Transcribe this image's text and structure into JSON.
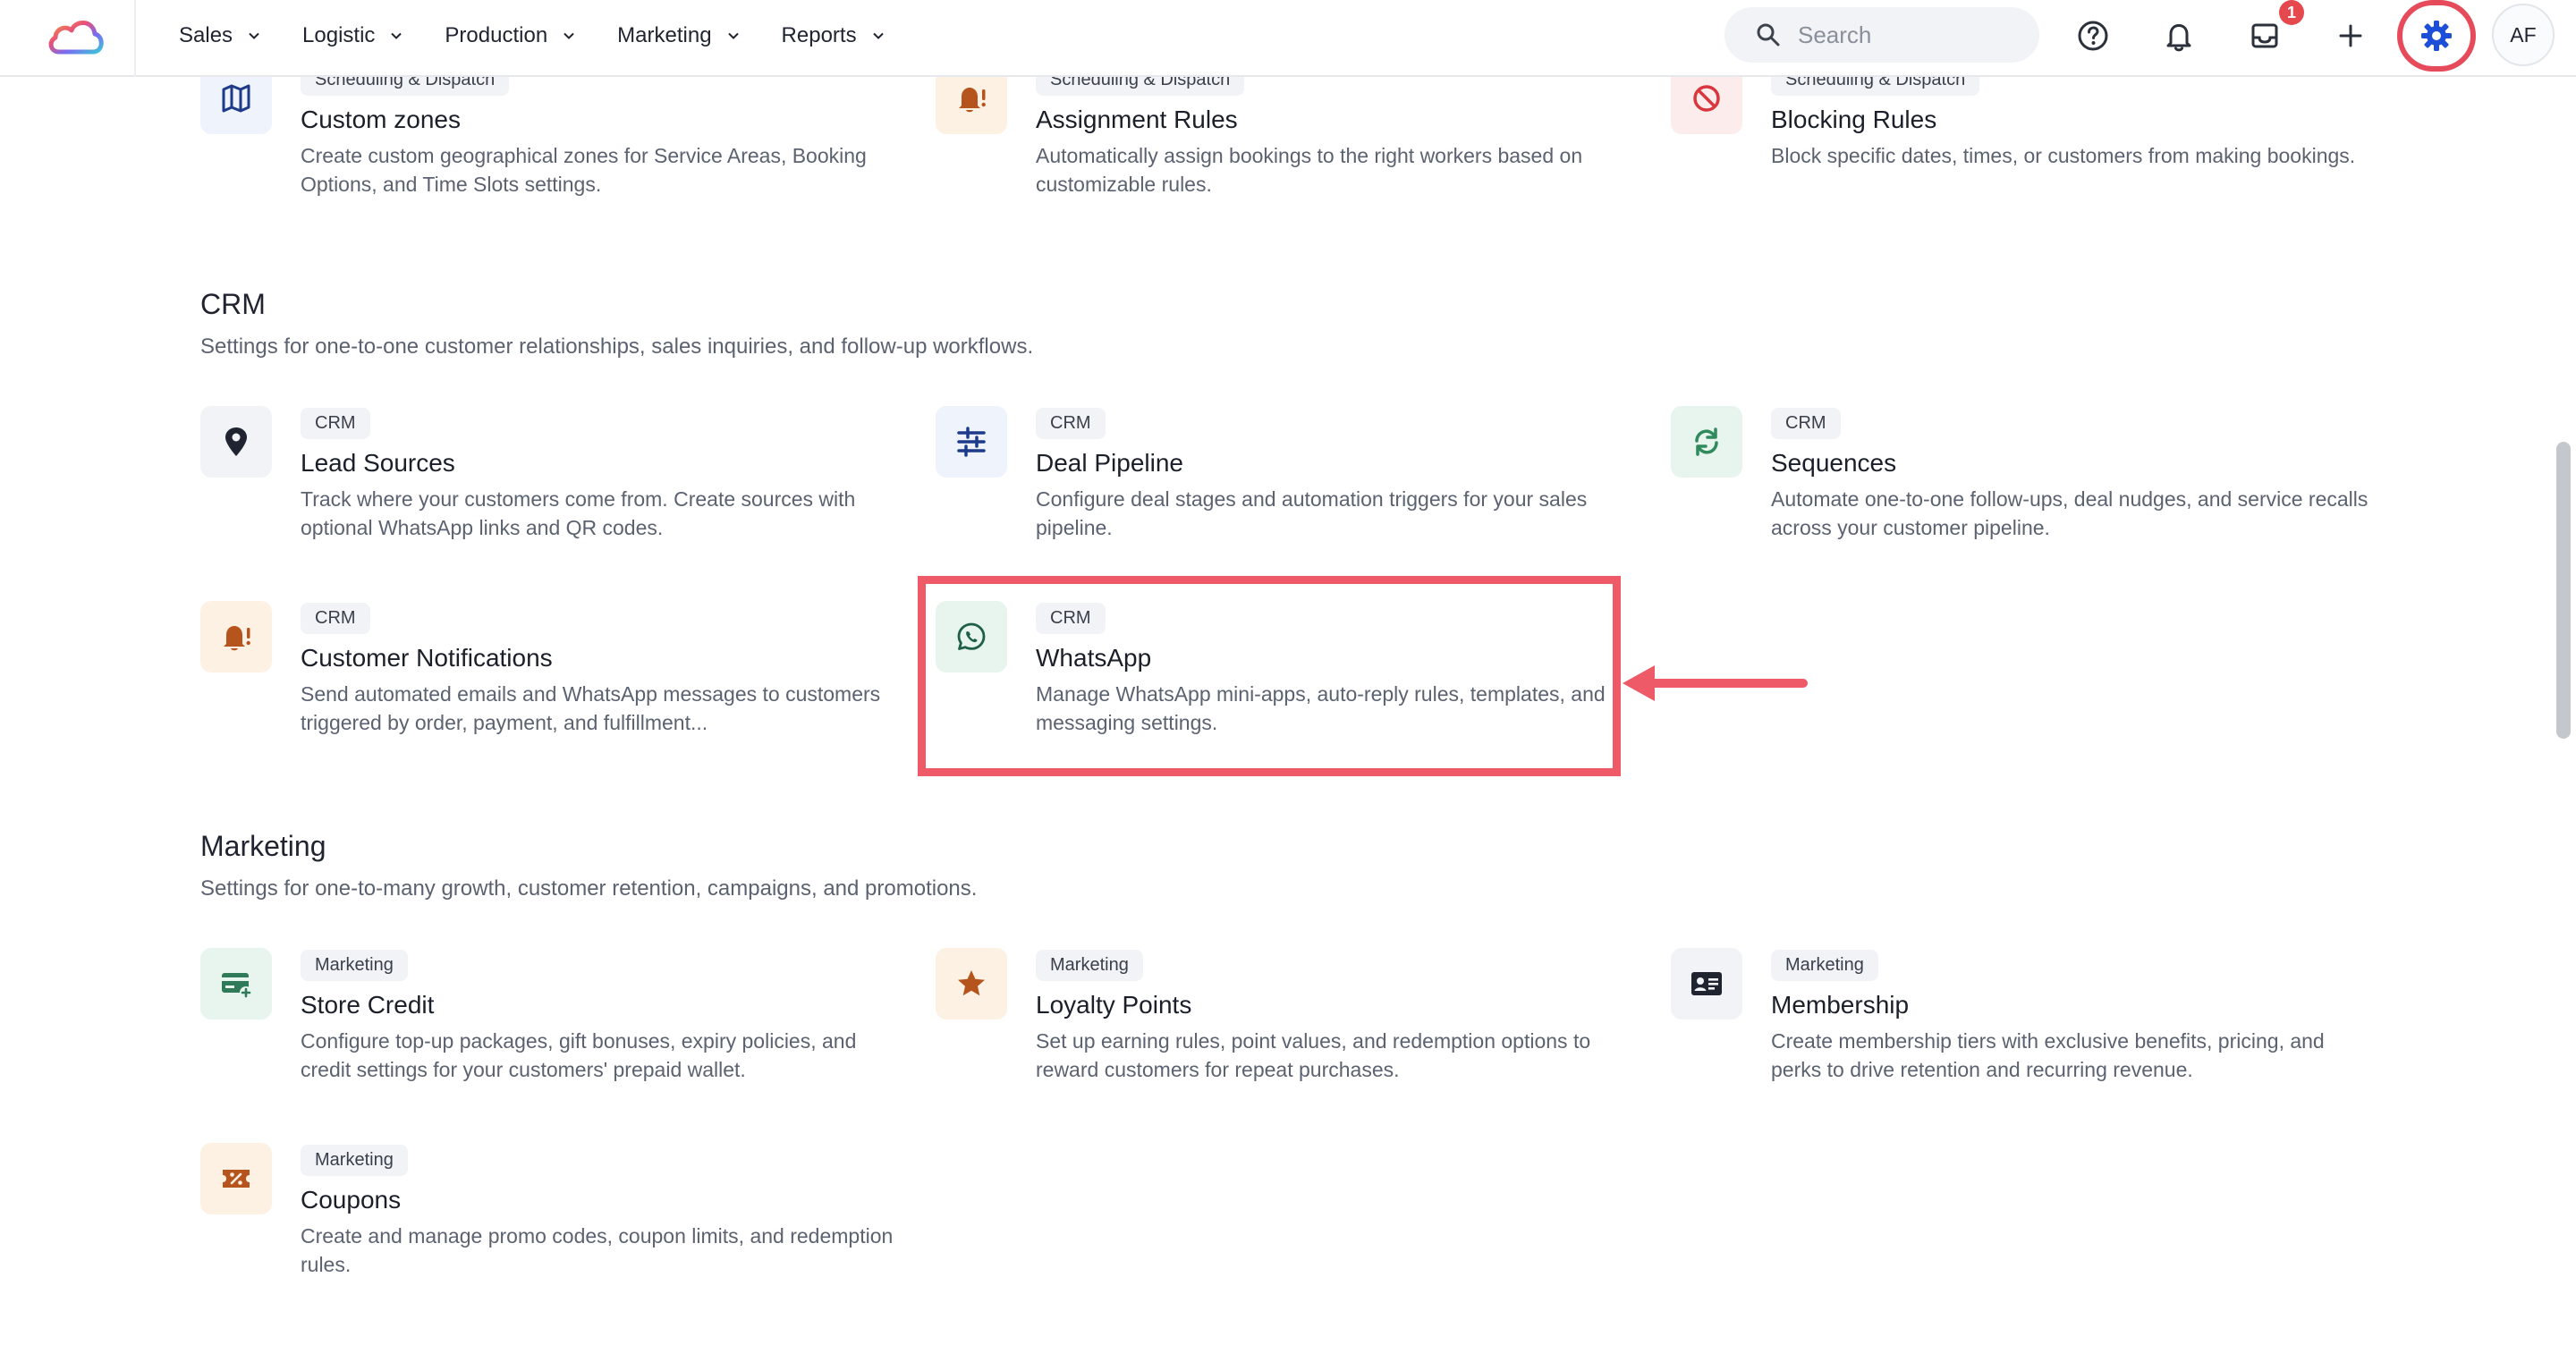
{
  "nav": {
    "items": [
      {
        "label": "Sales"
      },
      {
        "label": "Logistic"
      },
      {
        "label": "Production"
      },
      {
        "label": "Marketing"
      },
      {
        "label": "Reports"
      }
    ]
  },
  "search": {
    "placeholder": "Search"
  },
  "header_icons": {
    "help": "help-circle-icon",
    "notifications": "bell-icon",
    "inbox": "inbox-icon",
    "inbox_badge": "1",
    "add": "plus-icon",
    "settings": "gear-icon",
    "avatar_initials": "AF"
  },
  "top_cards": [
    {
      "tag": "Scheduling & Dispatch",
      "title": "Custom zones",
      "desc": "Create custom geographical zones for Service Areas, Booking Options, and Time Slots settings.",
      "icon": "map-icon"
    },
    {
      "tag": "Scheduling & Dispatch",
      "title": "Assignment Rules",
      "desc": "Automatically assign bookings to the right workers based on customizable rules.",
      "icon": "bell-alert-icon"
    },
    {
      "tag": "Scheduling & Dispatch",
      "title": "Blocking Rules",
      "desc": "Block specific dates, times, or customers from making bookings.",
      "icon": "block-icon"
    }
  ],
  "crm": {
    "title": "CRM",
    "desc": "Settings for one-to-one customer relationships, sales inquiries, and follow-up workflows.",
    "cards": [
      {
        "tag": "CRM",
        "title": "Lead Sources",
        "desc": "Track where your customers come from. Create sources with optional WhatsApp links and QR codes.",
        "icon": "location-pin-icon"
      },
      {
        "tag": "CRM",
        "title": "Deal Pipeline",
        "desc": "Configure deal stages and automation triggers for your sales pipeline.",
        "icon": "pipeline-icon"
      },
      {
        "tag": "CRM",
        "title": "Sequences",
        "desc": "Automate one-to-one follow-ups, deal nudges, and service recalls across your customer pipeline.",
        "icon": "refresh-icon"
      },
      {
        "tag": "CRM",
        "title": "Customer Notifications",
        "desc": "Send automated emails and WhatsApp messages to customers triggered by order, payment, and fulfillment...",
        "icon": "bell-alert-icon"
      },
      {
        "tag": "CRM",
        "title": "WhatsApp",
        "desc": "Manage WhatsApp mini-apps, auto-reply rules, templates, and messaging settings.",
        "icon": "whatsapp-icon"
      }
    ]
  },
  "marketing": {
    "title": "Marketing",
    "desc": "Settings for one-to-many growth, customer retention, campaigns, and promotions.",
    "cards": [
      {
        "tag": "Marketing",
        "title": "Store Credit",
        "desc": "Configure top-up packages, gift bonuses, expiry policies, and credit settings for your customers' prepaid wallet.",
        "icon": "card-plus-icon"
      },
      {
        "tag": "Marketing",
        "title": "Loyalty Points",
        "desc": "Set up earning rules, point values, and redemption options to reward customers for repeat purchases.",
        "icon": "star-icon"
      },
      {
        "tag": "Marketing",
        "title": "Membership",
        "desc": "Create membership tiers with exclusive benefits, pricing, and perks to drive retention and recurring revenue.",
        "icon": "id-card-icon"
      },
      {
        "tag": "Marketing",
        "title": "Coupons",
        "desc": "Create and manage promo codes, coupon limits, and redemption rules.",
        "icon": "coupon-icon"
      }
    ]
  },
  "colors": {
    "highlight": "#ee5a67",
    "accent_blue": "#1e3a8a",
    "accent_orange": "#b5541c",
    "accent_red": "#d9363e",
    "accent_green": "#2f8a5c"
  }
}
